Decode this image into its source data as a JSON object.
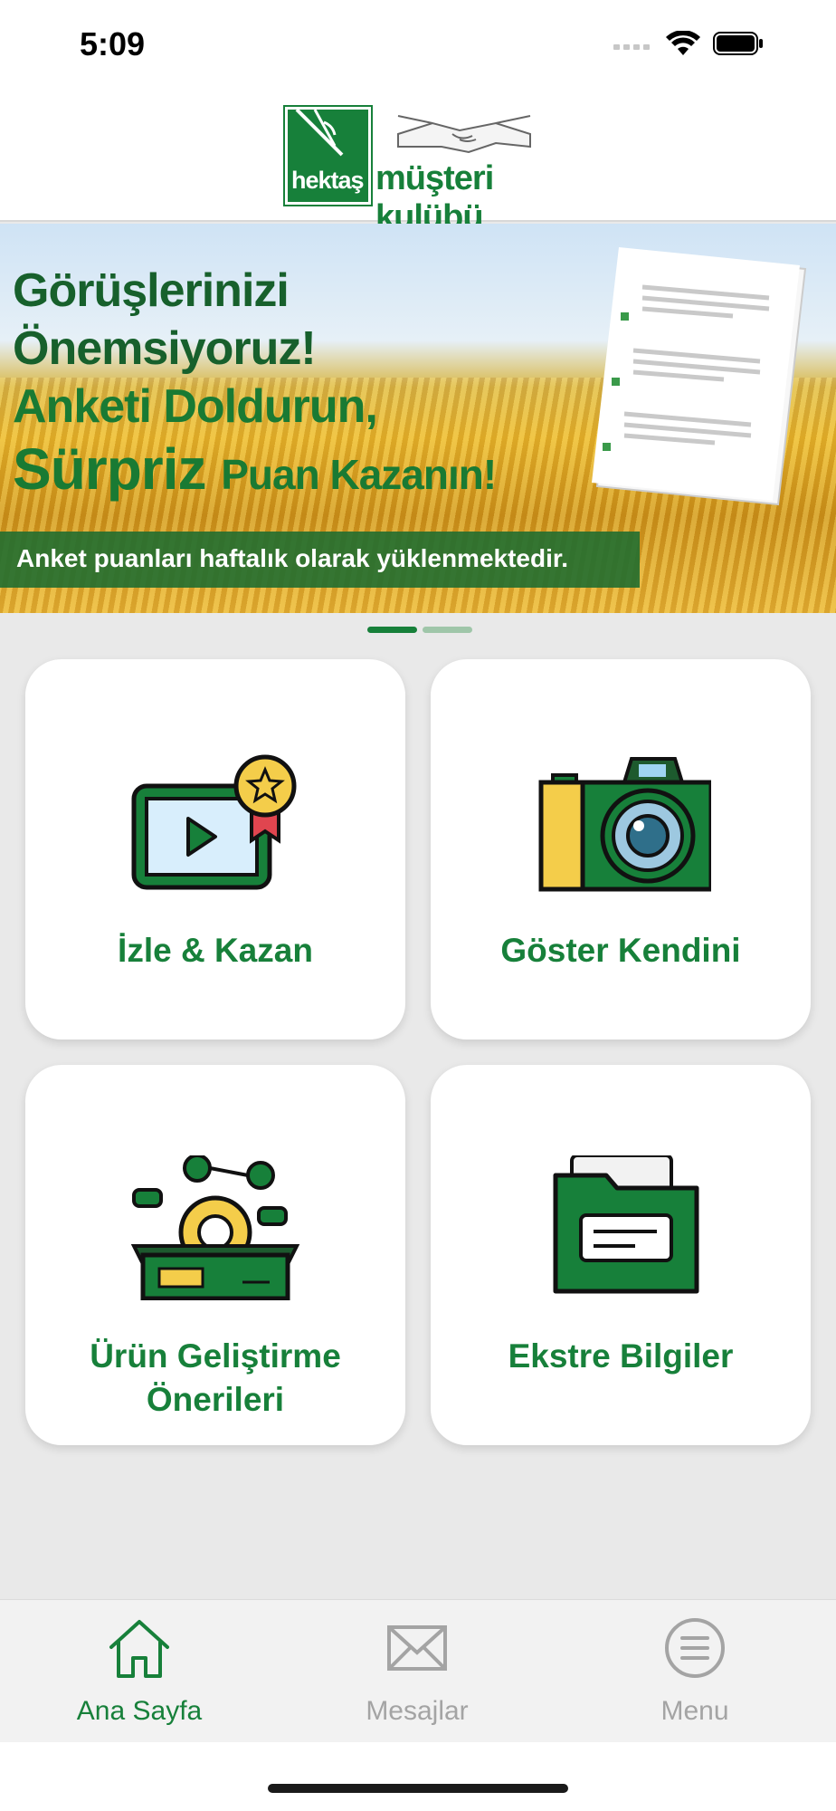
{
  "status_bar": {
    "time": "5:09"
  },
  "header": {
    "logo_mark": "hektaş",
    "logo_word": "müşteri kulübü"
  },
  "banner": {
    "line1": "Görüşlerinizi",
    "line2": "Önemsiyoruz!",
    "line3": "Anketi Doldurun,",
    "line4_big": "Sürpriz",
    "line4_small": "Puan Kazanın!",
    "strip": "Anket puanları haftalık olarak yüklenmektedir."
  },
  "pager": {
    "count": 2,
    "active_index": 0
  },
  "cards": [
    {
      "label": "İzle & Kazan",
      "icon": "video-reward-icon"
    },
    {
      "label": "Göster Kendini",
      "icon": "camera-icon"
    },
    {
      "label": "Ürün Geliştirme Önerileri",
      "label_line1": "Ürün Geliştirme",
      "label_line2": "Önerileri",
      "icon": "product-box-gear-icon"
    },
    {
      "label": "Ekstre Bilgiler",
      "icon": "folder-document-icon"
    }
  ],
  "tabbar": {
    "home": "Ana Sayfa",
    "messages": "Mesajlar",
    "menu": "Menu"
  },
  "colors": {
    "brand_green": "#17803a",
    "inactive": "#a4a4a4",
    "background": "#e9e9e9"
  }
}
